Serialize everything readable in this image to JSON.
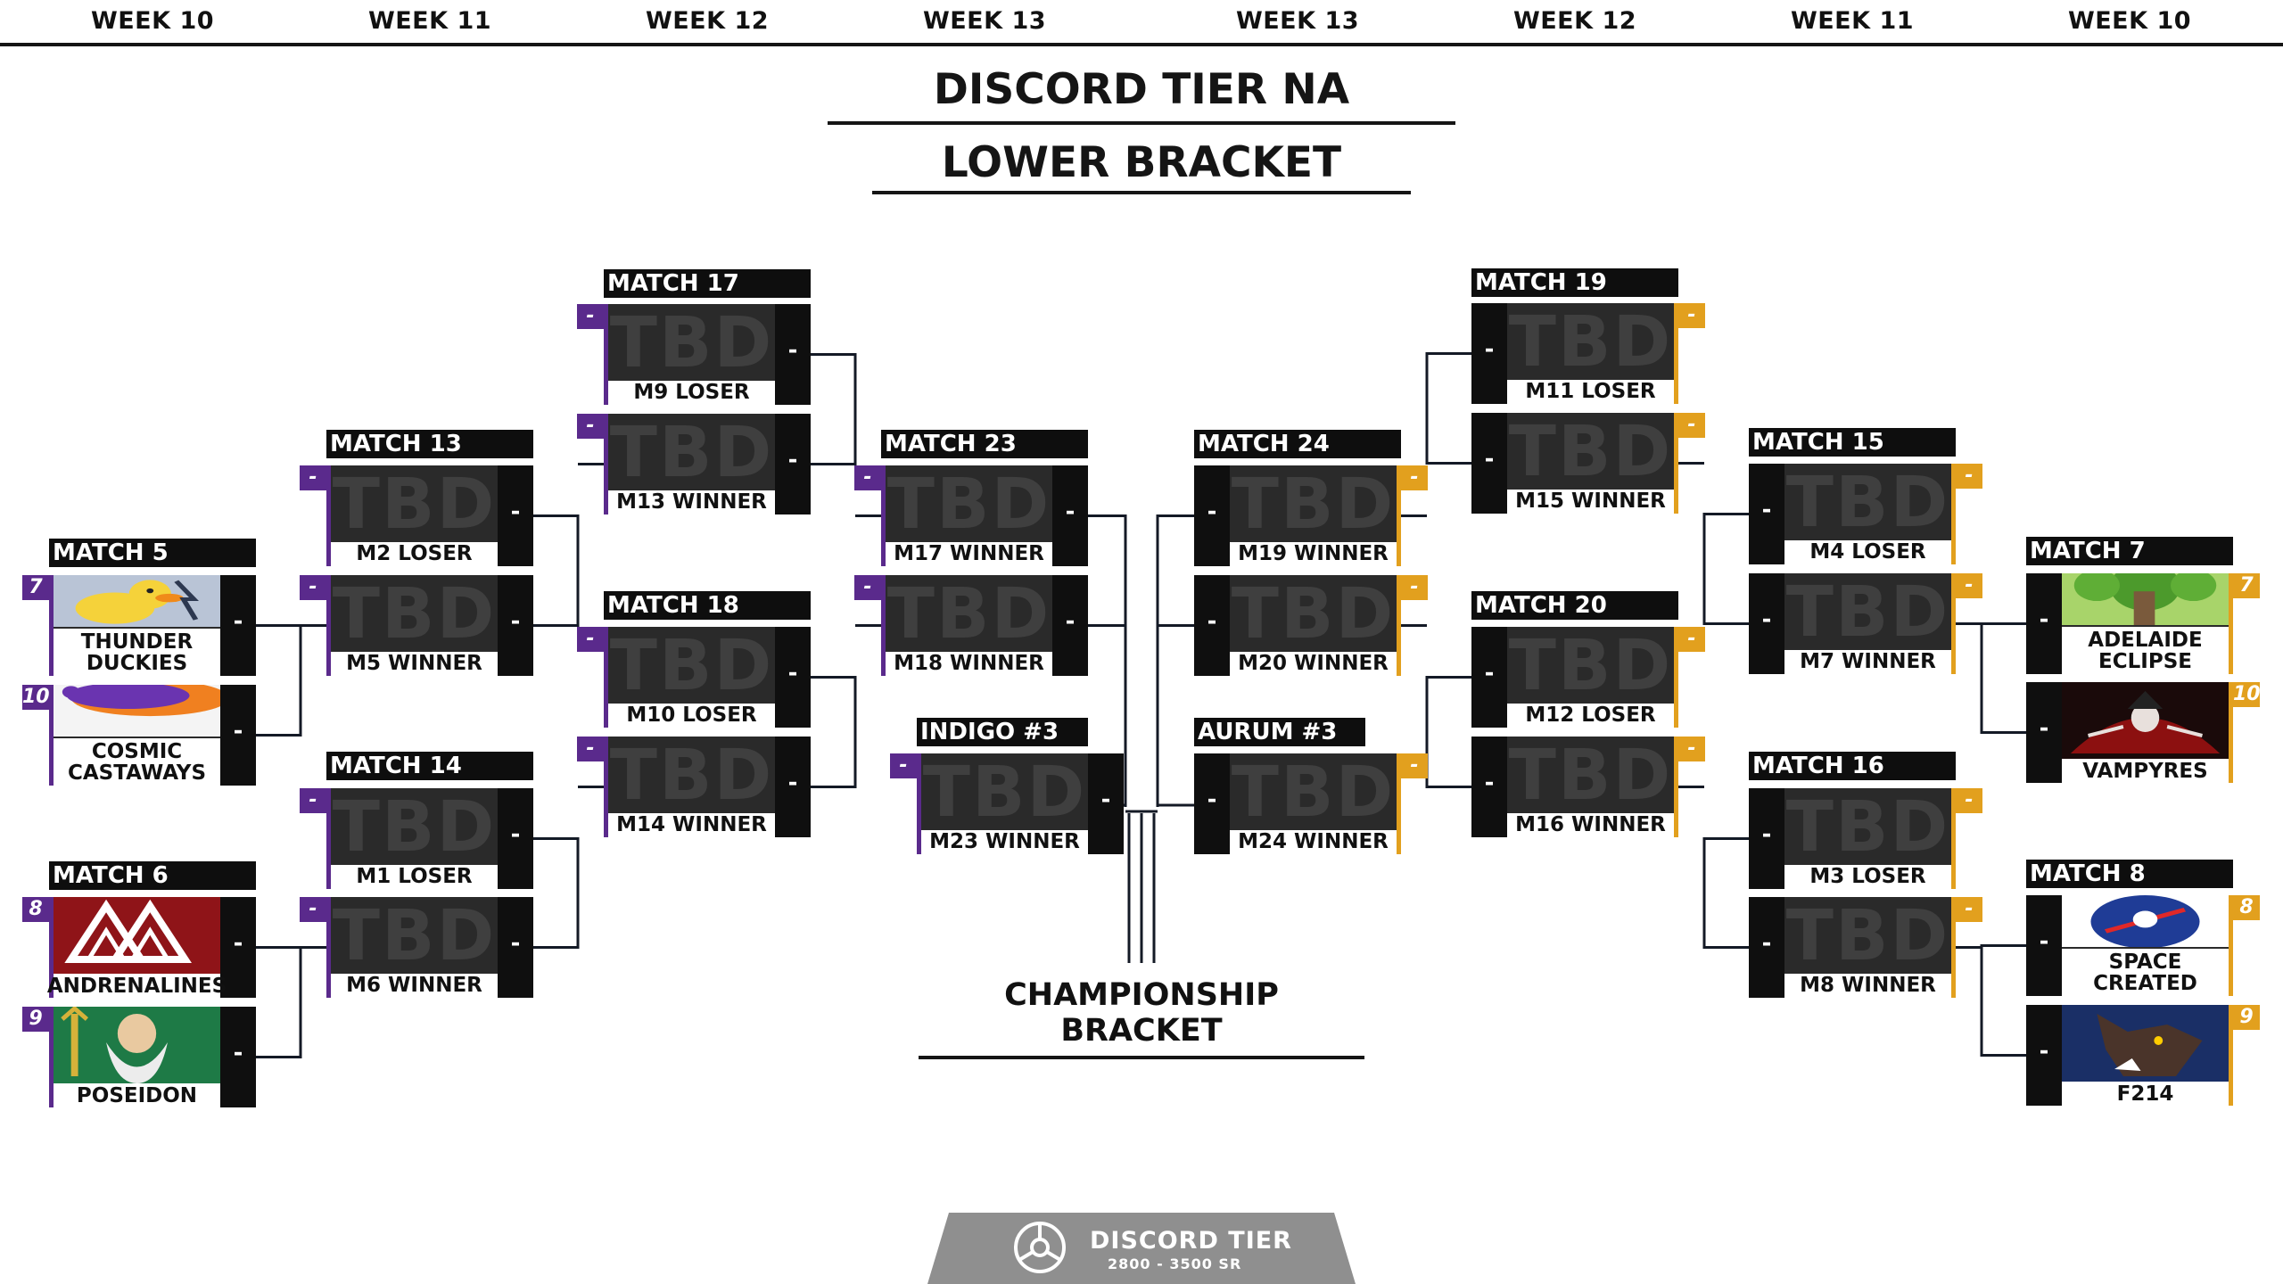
{
  "weeks": [
    "WEEK 10",
    "WEEK 11",
    "WEEK 12",
    "WEEK 13",
    "WEEK 13",
    "WEEK 12",
    "WEEK 11",
    "WEEK 10"
  ],
  "header": {
    "title": "DISCORD TIER NA",
    "subtitle": "LOWER BRACKET"
  },
  "colors": {
    "left_accent": "#5a2a8c",
    "right_accent": "#e2a01e",
    "tile_bg": "#2a2a2a",
    "label_bg": "#0e0e0e"
  },
  "placeholder": "TBD",
  "score_placeholder": "-",
  "matches": [
    {
      "id": "m5",
      "label": "MATCH 5",
      "side": "left",
      "slots": [
        {
          "team": "THUNDER DUCKIES",
          "seed": "7",
          "art": "duck-logo"
        },
        {
          "team": "COSMIC CASTAWAYS",
          "seed": "10",
          "art": "cosmic-logo"
        }
      ]
    },
    {
      "id": "m6",
      "label": "MATCH 6",
      "side": "left",
      "slots": [
        {
          "team": "ANDRENALINES",
          "seed": "8",
          "art": "andrenalines-logo"
        },
        {
          "team": "POSEIDON",
          "seed": "9",
          "art": "poseidon-logo"
        }
      ]
    },
    {
      "id": "m13",
      "label": "MATCH 13",
      "side": "left",
      "slots": [
        {
          "source": "M2 LOSER"
        },
        {
          "source": "M5 WINNER"
        }
      ]
    },
    {
      "id": "m14",
      "label": "MATCH 14",
      "side": "left",
      "slots": [
        {
          "source": "M1 LOSER"
        },
        {
          "source": "M6 WINNER"
        }
      ]
    },
    {
      "id": "m17",
      "label": "MATCH 17",
      "side": "left",
      "slots": [
        {
          "source": "M9 LOSER"
        },
        {
          "source": "M13 WINNER"
        }
      ]
    },
    {
      "id": "m18",
      "label": "MATCH 18",
      "side": "left",
      "slots": [
        {
          "source": "M10 LOSER"
        },
        {
          "source": "M14 WINNER"
        }
      ]
    },
    {
      "id": "m23",
      "label": "MATCH 23",
      "side": "left",
      "slots": [
        {
          "source": "M17 WINNER"
        },
        {
          "source": "M18 WINNER"
        }
      ]
    },
    {
      "id": "indigo",
      "label": "INDIGO #3",
      "side": "left",
      "slots": [
        {
          "source": "M23 WINNER"
        }
      ]
    },
    {
      "id": "m7",
      "label": "MATCH 7",
      "side": "right",
      "slots": [
        {
          "team": "ADELAIDE ECLIPSE",
          "seed": "7",
          "art": "adelaide-logo"
        },
        {
          "team": "VAMPYRES",
          "seed": "10",
          "art": "vampyres-logo"
        }
      ]
    },
    {
      "id": "m8",
      "label": "MATCH 8",
      "side": "right",
      "slots": [
        {
          "team": "SPACE CREATED",
          "seed": "8",
          "art": "space-created-logo"
        },
        {
          "team": "F214",
          "seed": "9",
          "art": "f214-logo"
        }
      ]
    },
    {
      "id": "m15",
      "label": "MATCH 15",
      "side": "right",
      "slots": [
        {
          "source": "M4 LOSER"
        },
        {
          "source": "M7 WINNER"
        }
      ]
    },
    {
      "id": "m16",
      "label": "MATCH 16",
      "side": "right",
      "slots": [
        {
          "source": "M3 LOSER"
        },
        {
          "source": "M8 WINNER"
        }
      ]
    },
    {
      "id": "m19",
      "label": "MATCH 19",
      "side": "right",
      "slots": [
        {
          "source": "M11 LOSER"
        },
        {
          "source": "M15 WINNER"
        }
      ]
    },
    {
      "id": "m20",
      "label": "MATCH 20",
      "side": "right",
      "slots": [
        {
          "source": "M12 LOSER"
        },
        {
          "source": "M16 WINNER"
        }
      ]
    },
    {
      "id": "m24",
      "label": "MATCH 24",
      "side": "right",
      "slots": [
        {
          "source": "M19 WINNER"
        },
        {
          "source": "M20 WINNER"
        }
      ]
    },
    {
      "id": "aurum",
      "label": "AURUM #3",
      "side": "right",
      "slots": [
        {
          "source": "M24 WINNER"
        }
      ]
    }
  ],
  "championship_label": "CHAMPIONSHIP BRACKET",
  "footer": {
    "title": "DISCORD TIER",
    "subtitle": "2800 - 3500 SR",
    "icon": "discord-tier-logo"
  }
}
